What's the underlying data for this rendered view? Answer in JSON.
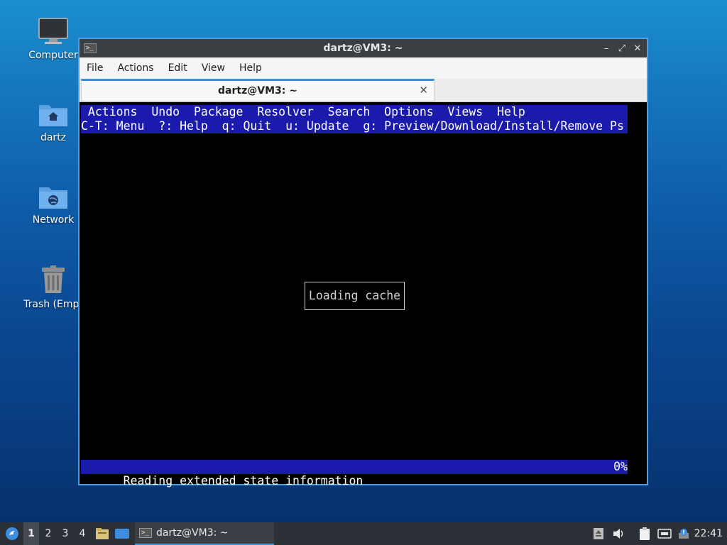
{
  "desktop": {
    "icons": [
      {
        "label": "Computer",
        "icon": "monitor-icon"
      },
      {
        "label": "dartz",
        "icon": "home-folder-icon"
      },
      {
        "label": "Network",
        "icon": "network-folder-icon"
      },
      {
        "label": "Trash (Empt",
        "icon": "trash-icon"
      }
    ]
  },
  "window": {
    "title": "dartz@VM3: ~",
    "app_icon": ">_",
    "controls": {
      "minimize": "–",
      "maximize": "⤢",
      "close": "✕"
    },
    "menu": [
      "File",
      "Actions",
      "Edit",
      "View",
      "Help"
    ],
    "tab": {
      "label": "dartz@VM3: ~",
      "close": "✕"
    }
  },
  "terminal": {
    "menu_line": " Actions  Undo  Package  Resolver  Search  Options  Views  Help",
    "keys_line": "C-T: Menu  ?: Help  q: Quit  u: Update  g: Preview/Download/Install/Remove Ps",
    "dialog": "Loading cache",
    "status_text": "Reading extended state information",
    "status_percent": "0%"
  },
  "taskbar": {
    "workspaces": [
      "1",
      "2",
      "3",
      "4"
    ],
    "active_workspace": "1",
    "task_label": "dartz@VM3: ~",
    "clock": "22:41"
  },
  "colors": {
    "accent": "#3d8ee0",
    "terminal_bar": "#1a1aad"
  }
}
